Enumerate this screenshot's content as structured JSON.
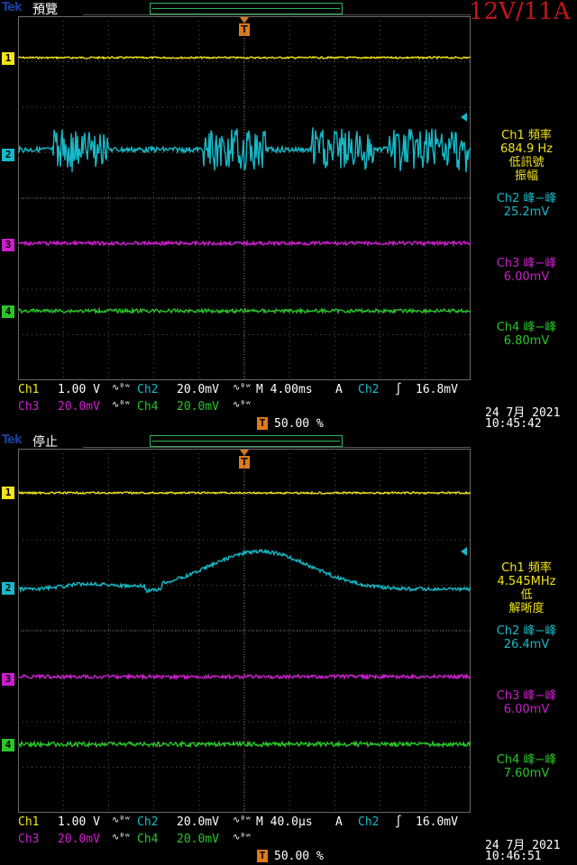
{
  "screens": [
    {
      "logo": "Tek",
      "state": "預覽",
      "title": "12V/11A",
      "trigger_glyph": "T",
      "channels": [
        "1",
        "2",
        "3",
        "4"
      ],
      "measurements": {
        "ch1": [
          "Ch1 頻率",
          "684.9 Hz",
          "低訊號",
          "振幅"
        ],
        "ch2": [
          "Ch2 峰−峰",
          "25.2mV"
        ],
        "ch3": [
          "Ch3 峰−峰",
          "6.00mV"
        ],
        "ch4": [
          "Ch4 峰−峰",
          "6.80mV"
        ]
      },
      "scale": {
        "ch1_label": "Ch1",
        "ch1_value": "1.00 V",
        "ch1_bw": "∿ᴮʷ",
        "ch2_label": "Ch2",
        "ch2_value": "20.0mV",
        "ch2_bw": "∿ᴮʷ",
        "ch3_label": "Ch3",
        "ch3_value": "20.0mV",
        "ch3_bw": "∿ᴮʷ",
        "ch4_label": "Ch4",
        "ch4_value": "20.0mV",
        "ch4_bw": "∿ᴮʷ",
        "timebase": "M 4.00ms",
        "acq": "A",
        "trig_source": "Ch2",
        "trig_slope": "∫",
        "trig_level": "16.8mV",
        "trig_pos": "50.00 %"
      },
      "date": "24 7月  2021",
      "time": "10:45:42"
    },
    {
      "logo": "Tek",
      "state": "停止",
      "trigger_glyph": "T",
      "channels": [
        "1",
        "2",
        "3",
        "4"
      ],
      "measurements": {
        "ch1": [
          "Ch1 頻率",
          "4.545MHz",
          "低",
          "解晰度"
        ],
        "ch2": [
          "Ch2 峰−峰",
          "26.4mV"
        ],
        "ch3": [
          "Ch3 峰−峰",
          "6.00mV"
        ],
        "ch4": [
          "Ch4 峰−峰",
          "7.60mV"
        ]
      },
      "scale": {
        "ch1_label": "Ch1",
        "ch1_value": "1.00 V",
        "ch1_bw": "∿ᴮʷ",
        "ch2_label": "Ch2",
        "ch2_value": "20.0mV",
        "ch2_bw": "∿ᴮʷ",
        "ch3_label": "Ch3",
        "ch3_value": "20.0mV",
        "ch3_bw": "∿ᴮʷ",
        "ch4_label": "Ch4",
        "ch4_value": "20.0mV",
        "ch4_bw": "∿ᴮʷ",
        "timebase": "M 40.0µs",
        "acq": "A",
        "trig_source": "Ch2",
        "trig_slope": "∫",
        "trig_level": "16.0mV",
        "trig_pos": "50.00 %"
      },
      "date": "24 7月  2021",
      "time": "10:46:51"
    }
  ],
  "colors": {
    "ch1": "#f2e41a",
    "ch2": "#17b9c8",
    "ch3": "#cc1fcc",
    "ch4": "#2bc52b",
    "trigger": "#e07a18",
    "title": "#c4141b"
  }
}
